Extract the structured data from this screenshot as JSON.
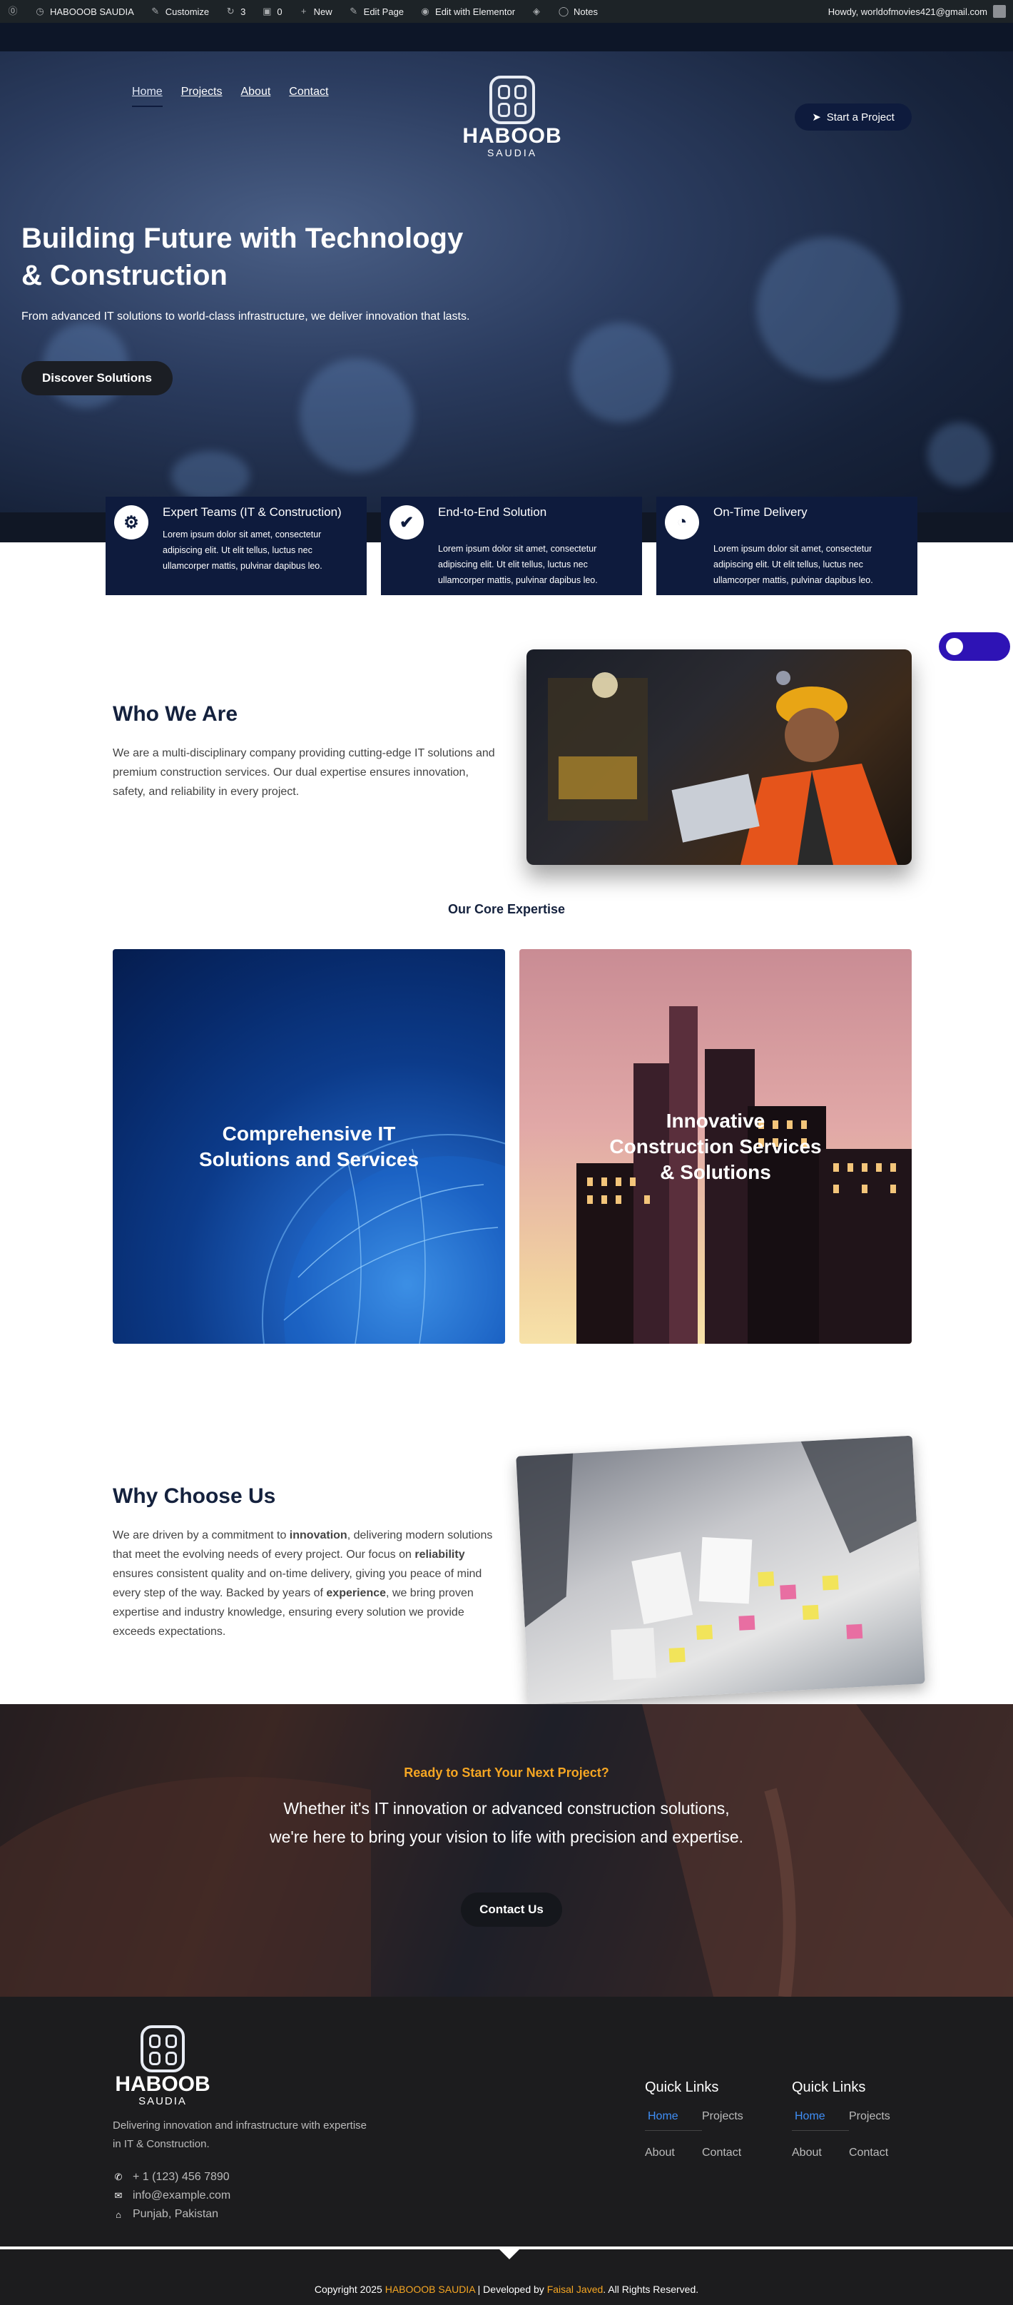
{
  "adminbar": {
    "site_name": "HABOOOB SAUDIA",
    "customize": "Customize",
    "updates_count": "3",
    "comments_count": "0",
    "new": "New",
    "edit_page": "Edit Page",
    "edit_elementor": "Edit with Elementor",
    "notes": "Notes",
    "howdy": "Howdy, worldofmovies421@gmail.com"
  },
  "header": {
    "nav": [
      "Home",
      "Projects",
      "About",
      "Contact"
    ],
    "logo_name": "HABOOB",
    "logo_sub": "SAUDIA",
    "cta": "Start a Project",
    "cta_icon": "paper-plane-icon"
  },
  "hero": {
    "title_line1": "Building Future with Technology",
    "title_line2": "& Construction",
    "subtitle": "From advanced IT solutions to world-class infrastructure, we deliver innovation that lasts.",
    "button": "Discover Solutions"
  },
  "features": [
    {
      "icon": "steam-icon",
      "title": "Expert Teams (IT & Construction)",
      "text": "Lorem ipsum dolor sit amet, consectetur adipiscing elit. Ut elit tellus, luctus nec ullamcorper mattis, pulvinar dapibus leo."
    },
    {
      "icon": "check-icon",
      "title": "End-to-End Solution",
      "text": "Lorem ipsum dolor sit amet, consectetur adipiscing elit. Ut elit tellus, luctus nec ullamcorper mattis, pulvinar dapibus leo."
    },
    {
      "icon": "clock-icon",
      "title": "On-Time Delivery",
      "text": "Lorem ipsum dolor sit amet, consectetur adipiscing elit. Ut elit tellus, luctus nec ullamcorper mattis, pulvinar dapibus leo."
    }
  ],
  "who": {
    "title": "Who We Are",
    "text": "We are a multi-disciplinary company providing cutting-edge IT solutions and premium construction services. Our dual expertise ensures innovation, safety, and reliability in every project."
  },
  "expertise": {
    "title": "Our Core Expertise",
    "cards": [
      "Comprehensive IT Solutions and Services",
      "Innovative Construction Services & Solutions"
    ]
  },
  "why": {
    "title": "Why Choose Us",
    "p1": "We are driven by a commitment to ",
    "b1": "innovation",
    "p2": ", delivering modern solutions that meet the evolving needs of every project. Our focus on ",
    "b2": "reliability",
    "p3": " ensures consistent quality and on-time delivery, giving you peace of mind every step of the way. Backed by years of ",
    "b3": "experience",
    "p4": ", we bring proven expertise and industry knowledge, ensuring every solution we provide exceeds expectations."
  },
  "cta": {
    "kicker": "Ready to Start Your Next Project?",
    "line1": "Whether it's IT innovation or advanced construction solutions,",
    "line2": "we're here to bring your vision to life with precision and expertise.",
    "button": "Contact Us"
  },
  "footer": {
    "logo_name": "HABOOB",
    "logo_sub": "SAUDIA",
    "desc": "Delivering innovation and infrastructure with expertise in IT & Construction.",
    "phone": "+ 1 (123) 456 7890",
    "email": "info@example.com",
    "address": "Punjab, Pakistan",
    "quick_links_title": "Quick Links",
    "links": [
      "Home",
      "Projects",
      "About",
      "Contact"
    ],
    "copy_pre": "Copyright 2025 ",
    "copy_brand": "HABOOOB SAUDIA",
    "copy_mid": " | Developed by ",
    "copy_dev": "Faisal Javed",
    "copy_post": ". All Rights Reserved."
  },
  "colors": {
    "navy": "#0e1b3d",
    "accent_orange": "#f5a623",
    "link_blue": "#3f8ef6",
    "toggle_purple": "#2e13b5"
  }
}
